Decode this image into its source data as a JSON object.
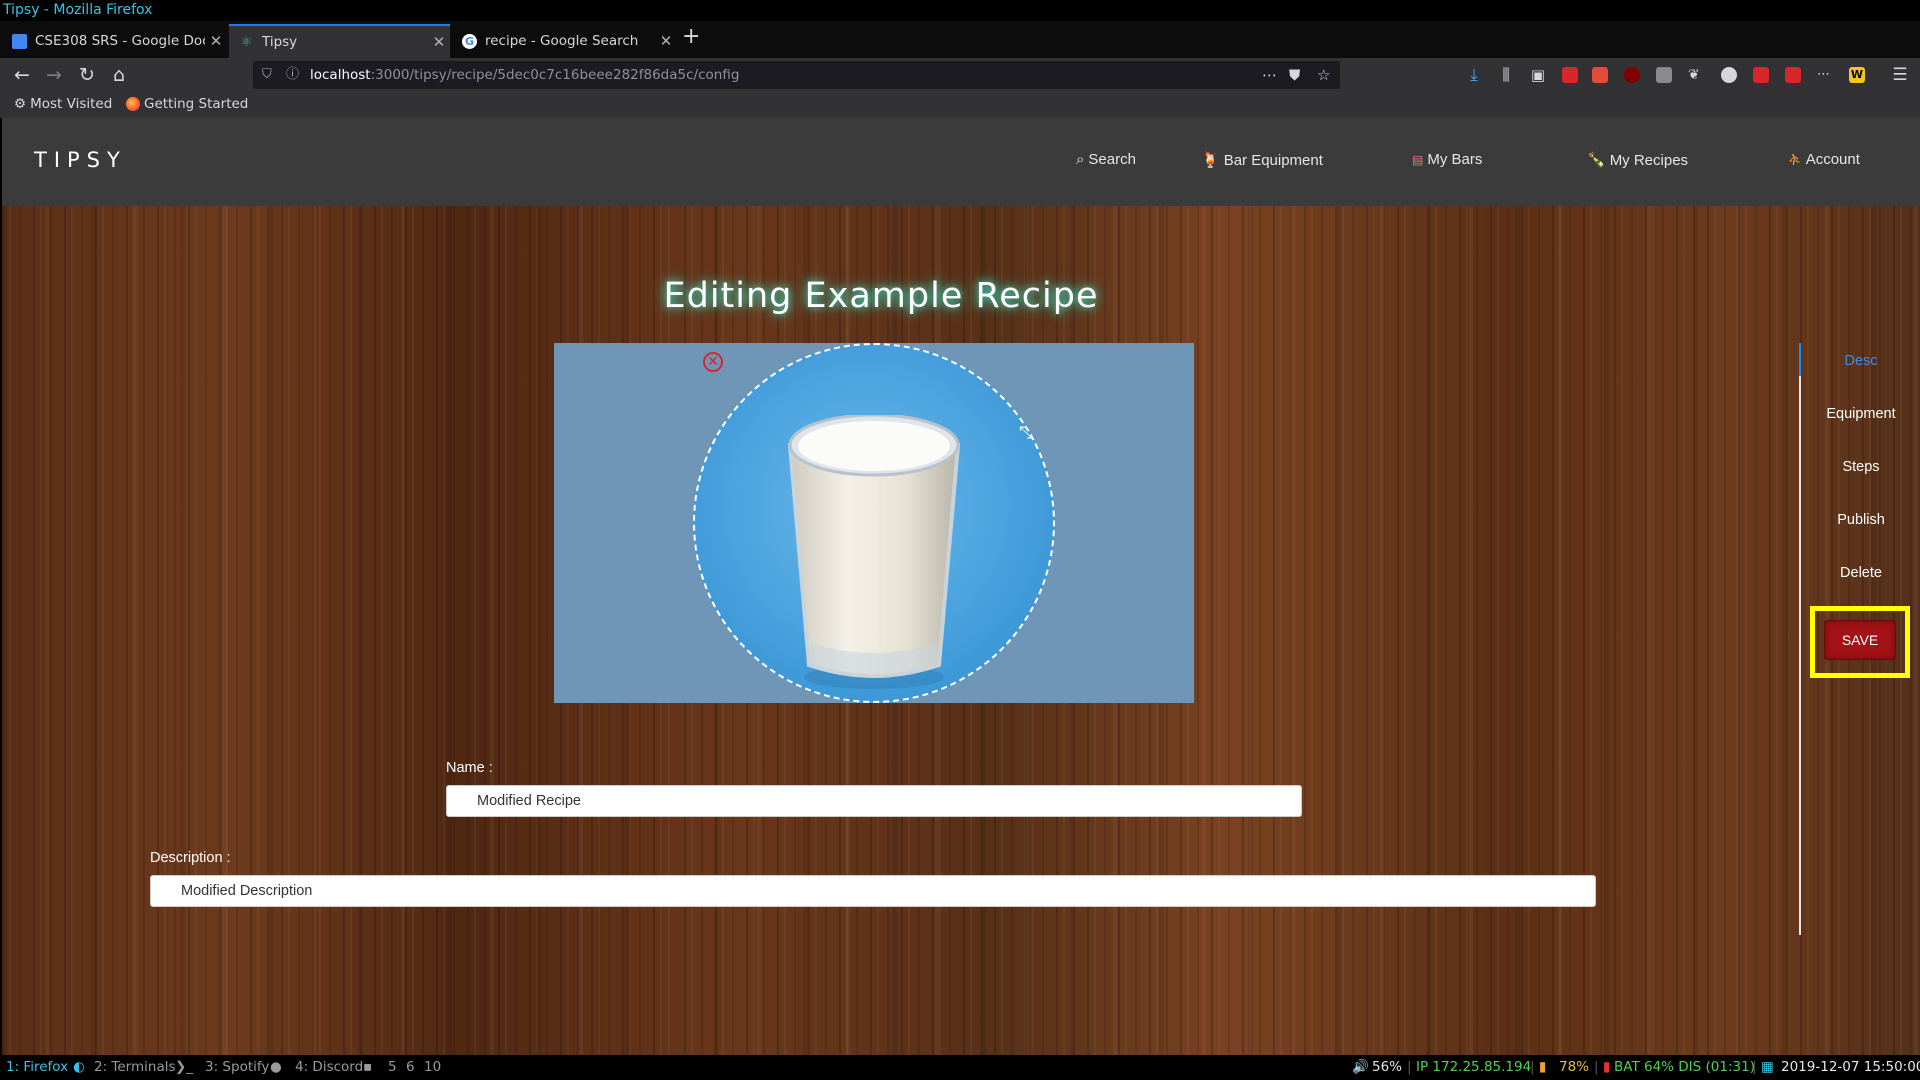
{
  "window": {
    "title": "Tipsy - Mozilla Firefox"
  },
  "tabs": [
    {
      "label": "CSE308 SRS - Google Docs",
      "icon": "google-docs-icon",
      "active": false
    },
    {
      "label": "Tipsy",
      "icon": "tipsy-favicon",
      "active": true
    },
    {
      "label": "recipe - Google Search",
      "icon": "google-icon",
      "active": false
    }
  ],
  "urlbar": {
    "host": "localhost",
    "path": ":3000/tipsy/recipe/5dec0c7c16beee282f86da5c/config"
  },
  "bookmarks": [
    {
      "label": "Most Visited",
      "icon": "gear-icon"
    },
    {
      "label": "Getting Started",
      "icon": "firefox-icon"
    }
  ],
  "app": {
    "brand": "TIPSY",
    "nav": [
      {
        "label": "Search",
        "icon": "search-icon"
      },
      {
        "label": "Bar Equipment",
        "icon": "bar-equipment-icon"
      },
      {
        "label": "My Bars",
        "icon": "bar-icon"
      },
      {
        "label": "My Recipes",
        "icon": "bottle-icon"
      },
      {
        "label": "Account",
        "icon": "account-icon"
      }
    ],
    "page_title": "Editing Example Recipe"
  },
  "form": {
    "name_label": "Name :",
    "name_value": "Modified Recipe",
    "description_label": "Description :",
    "description_value": "Modified Description"
  },
  "side_nav": {
    "items": [
      "Desc",
      "Equipment",
      "Steps",
      "Publish",
      "Delete"
    ],
    "active": "Desc",
    "save_label": "SAVE"
  },
  "statusbar": {
    "workspaces": [
      "1: Firefox",
      "2: Terminals",
      "3: Spotify",
      "4: Discord",
      "5",
      "6",
      "10"
    ],
    "volume": "56%",
    "ip": "IP 172.25.85.194",
    "wifi": "78%",
    "battery": "BAT 64% DIS (01:31)",
    "datetime": "2019-12-07 15:50:00"
  },
  "colors": {
    "accent": "#0a84ff",
    "save_button": "#a21216",
    "highlight": "#ffff00",
    "active_side": "#3b8fe0",
    "title_glow": "#3fe0c0"
  }
}
